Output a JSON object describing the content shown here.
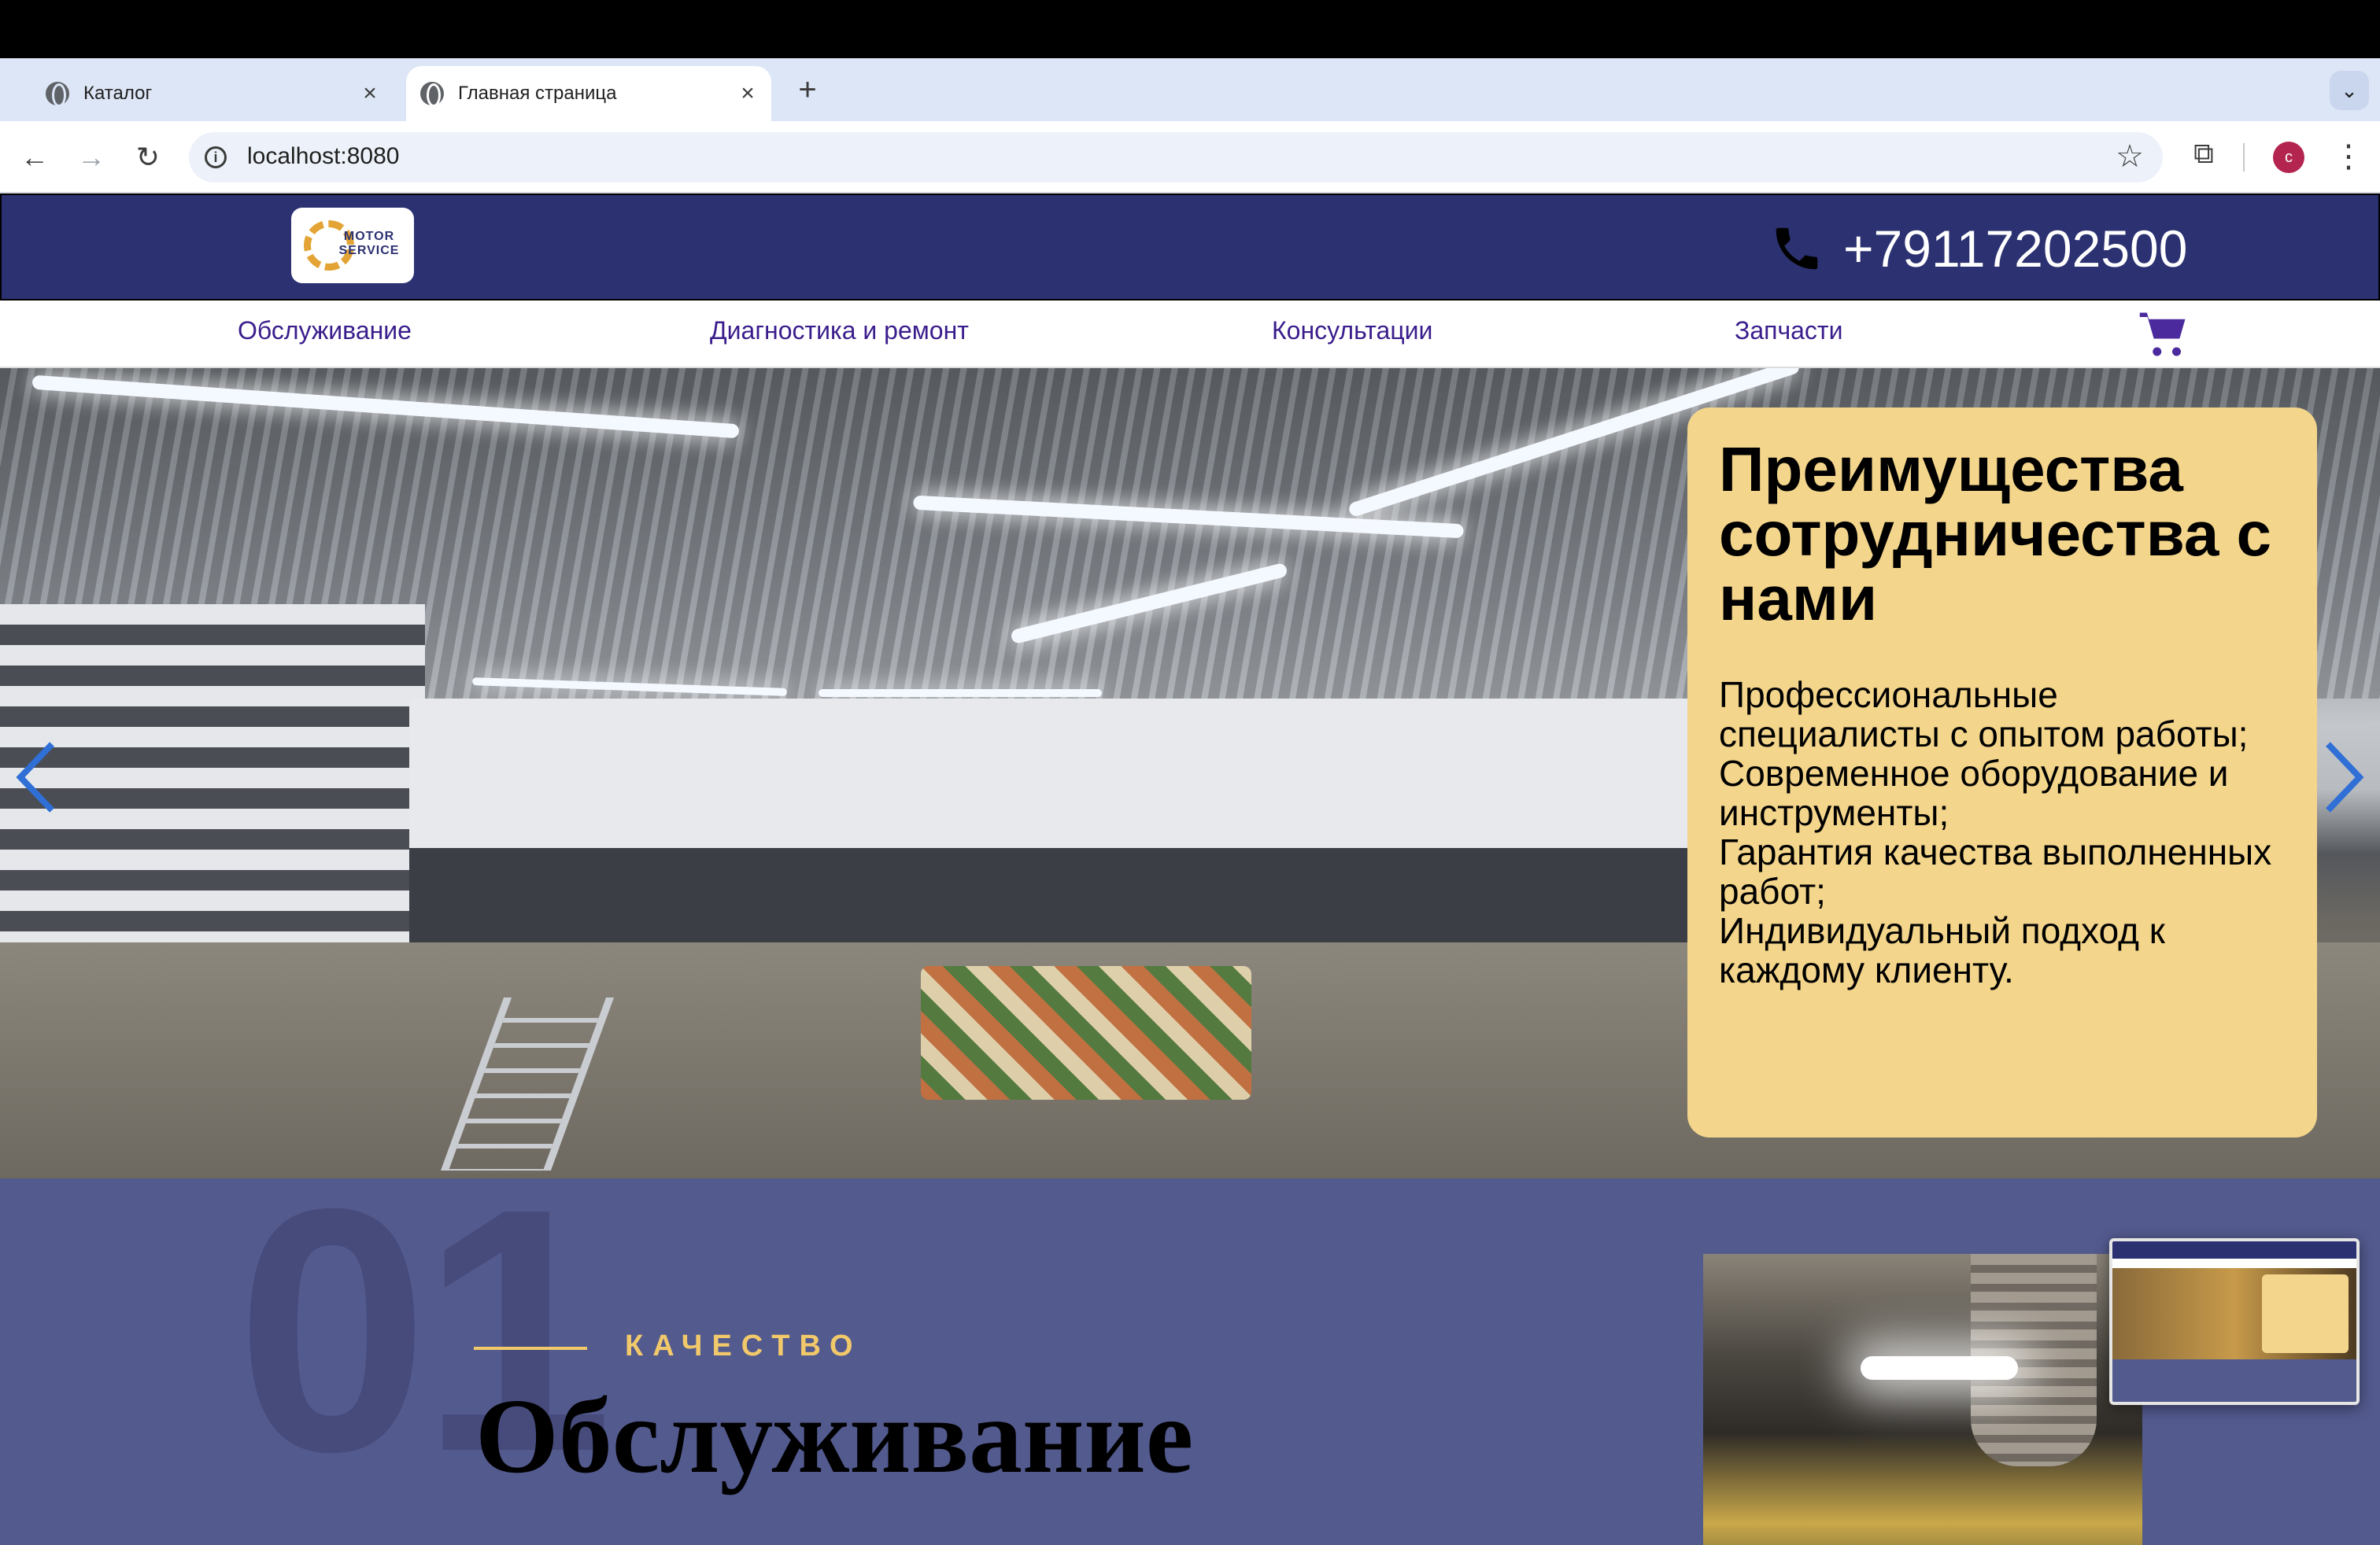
{
  "browser": {
    "tabs": [
      {
        "title": "Каталог",
        "active": false
      },
      {
        "title": "Главная страница",
        "active": true
      }
    ],
    "new_tab_label": "+",
    "tab_dropdown_label": "⌄",
    "close_glyph": "×",
    "url": "localhost:8080",
    "profile_initial": "c",
    "back_glyph": "←",
    "forward_glyph": "→",
    "reload_glyph": "↻",
    "star_glyph": "☆",
    "extensions_glyph": "⧉",
    "menu_glyph": "⋮",
    "info_glyph": "i"
  },
  "site": {
    "logo_text": "MOTOR SERVICE",
    "phone": "+79117202500",
    "nav": [
      "Обслуживание",
      "Диагностика и ремонт",
      "Консультации",
      "Запчасти"
    ],
    "colors": {
      "header_bg": "#2b3171",
      "nav_text": "#3a1d8c",
      "accent": "#f3d58b",
      "section_bg": "#535a8e"
    }
  },
  "hero": {
    "title": "Преимущества сотрудничества с нами",
    "items": [
      "Профессиональные специалисты с опытом работы;",
      "Современное оборудование и инструменты;",
      "Гарантия качества выполненных работ;",
      "Индивидуальный подход к каждому клиенту."
    ]
  },
  "section": {
    "number": "01",
    "eyebrow": "КАЧЕСТВО",
    "title": "Обслуживание"
  }
}
